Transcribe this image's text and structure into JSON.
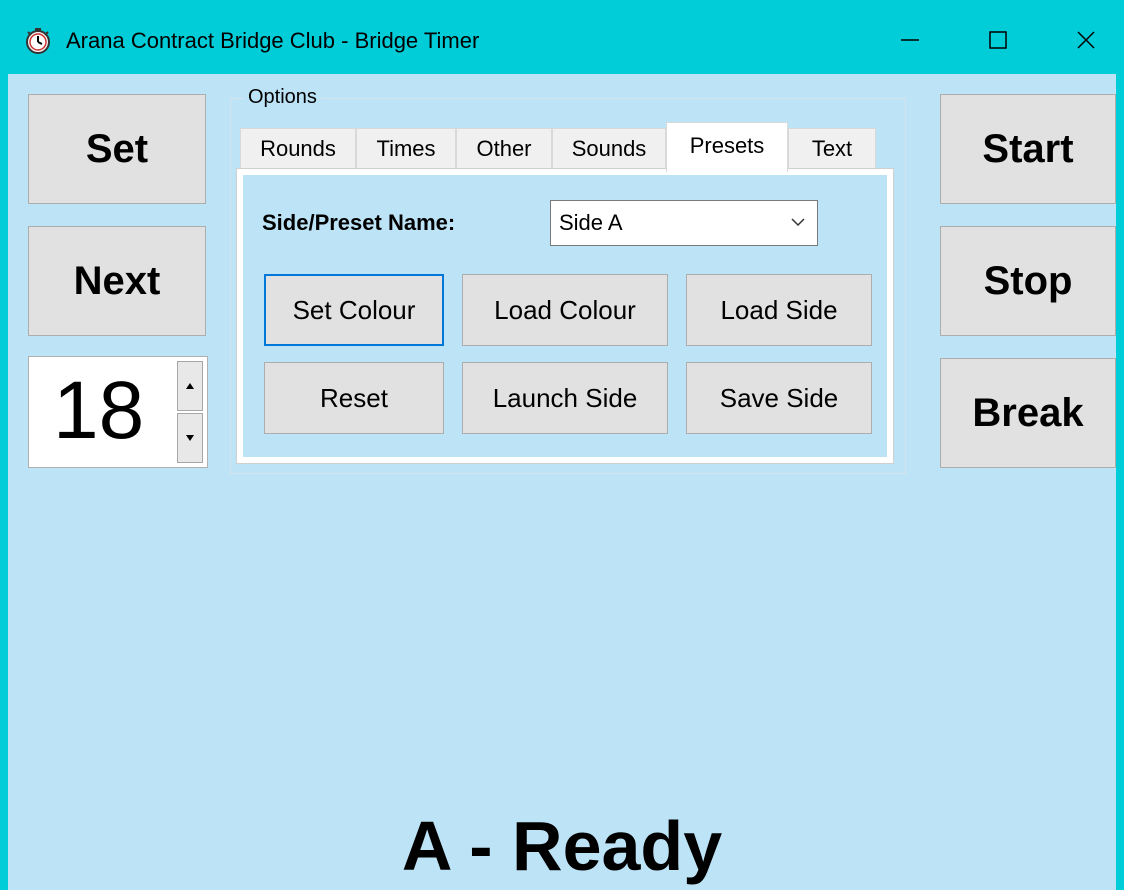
{
  "window": {
    "title": "Arana Contract Bridge Club - Bridge Timer",
    "icon": "stopwatch-icon",
    "controls": [
      "minimize-icon",
      "maximize-icon",
      "close-icon"
    ],
    "colors": {
      "titlebar": "#00cdd8",
      "background": "#bde3f7",
      "focus": "#0078d7"
    }
  },
  "left": {
    "set_label": "Set",
    "next_label": "Next",
    "round_value": "18"
  },
  "right": {
    "start_label": "Start",
    "stop_label": "Stop",
    "break_label": "Break"
  },
  "options": {
    "group_title": "Options",
    "tabs": [
      {
        "label": "Rounds"
      },
      {
        "label": "Times"
      },
      {
        "label": "Other"
      },
      {
        "label": "Sounds"
      },
      {
        "label": "Presets"
      },
      {
        "label": "Text"
      }
    ],
    "active_tab": "Presets",
    "presets": {
      "name_label": "Side/Preset Name:",
      "name_value": "Side A",
      "buttons": {
        "set_colour": "Set Colour",
        "load_colour": "Load Colour",
        "load_side": "Load Side",
        "reset": "Reset",
        "launch_side": "Launch Side",
        "save_side": "Save Side"
      }
    }
  },
  "status": {
    "text": "A - Ready"
  }
}
